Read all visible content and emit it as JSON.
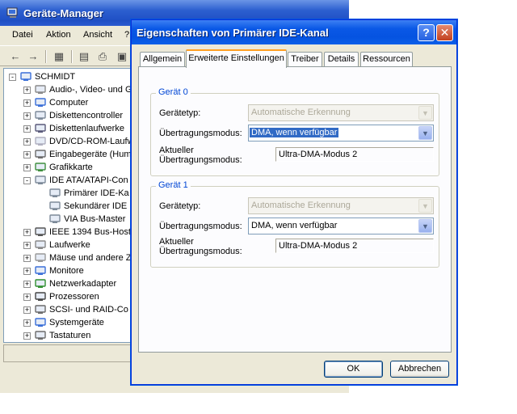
{
  "device_manager": {
    "title": "Geräte-Manager",
    "menu": [
      "Datei",
      "Aktion",
      "Ansicht",
      "?"
    ],
    "tree": [
      {
        "label": "SCHMIDT",
        "indent": 0,
        "expander": "-",
        "icon": "computer-icon"
      },
      {
        "label": "Audio-, Video- und G",
        "indent": 1,
        "expander": "+",
        "icon": "sound-icon"
      },
      {
        "label": "Computer",
        "indent": 1,
        "expander": "+",
        "icon": "computer-icon"
      },
      {
        "label": "Diskettencontroller",
        "indent": 1,
        "expander": "+",
        "icon": "controller-icon"
      },
      {
        "label": "Diskettenlaufwerke",
        "indent": 1,
        "expander": "+",
        "icon": "floppy-icon"
      },
      {
        "label": "DVD/CD-ROM-Laufw",
        "indent": 1,
        "expander": "+",
        "icon": "cdrom-icon"
      },
      {
        "label": "Eingabegeräte (Hum",
        "indent": 1,
        "expander": "+",
        "icon": "keyboard-icon"
      },
      {
        "label": "Grafikkarte",
        "indent": 1,
        "expander": "+",
        "icon": "display-icon"
      },
      {
        "label": "IDE ATA/ATAPI-Con",
        "indent": 1,
        "expander": "-",
        "icon": "controller-icon"
      },
      {
        "label": "Primärer IDE-Ka",
        "indent": 2,
        "expander": "",
        "icon": "controller-icon"
      },
      {
        "label": "Sekundärer IDE",
        "indent": 2,
        "expander": "",
        "icon": "controller-icon"
      },
      {
        "label": "VIA Bus-Master",
        "indent": 2,
        "expander": "",
        "icon": "controller-icon"
      },
      {
        "label": "IEEE 1394 Bus-Host",
        "indent": 1,
        "expander": "+",
        "icon": "ieee-icon"
      },
      {
        "label": "Laufwerke",
        "indent": 1,
        "expander": "+",
        "icon": "drive-icon"
      },
      {
        "label": "Mäuse und andere Z",
        "indent": 1,
        "expander": "+",
        "icon": "mouse-icon"
      },
      {
        "label": "Monitore",
        "indent": 1,
        "expander": "+",
        "icon": "monitor-icon"
      },
      {
        "label": "Netzwerkadapter",
        "indent": 1,
        "expander": "+",
        "icon": "network-icon"
      },
      {
        "label": "Prozessoren",
        "indent": 1,
        "expander": "+",
        "icon": "cpu-icon"
      },
      {
        "label": "SCSI- und RAID-Co",
        "indent": 1,
        "expander": "+",
        "icon": "scsi-icon"
      },
      {
        "label": "Systemgeräte",
        "indent": 1,
        "expander": "+",
        "icon": "system-icon"
      },
      {
        "label": "Tastaturen",
        "indent": 1,
        "expander": "+",
        "icon": "keyboard-icon"
      }
    ]
  },
  "dialog": {
    "title": "Eigenschaften von Primärer IDE-Kanal",
    "help_glyph": "?",
    "close_glyph": "✕",
    "tabs": [
      {
        "label": "Allgemein",
        "active": false
      },
      {
        "label": "Erweiterte Einstellungen",
        "active": true
      },
      {
        "label": "Treiber",
        "active": false
      },
      {
        "label": "Details",
        "active": false
      },
      {
        "label": "Ressourcen",
        "active": false
      }
    ],
    "groups": [
      {
        "title": "Gerät 0",
        "device_type_label": "Gerätetyp:",
        "device_type_value": "Automatische Erkennung",
        "transfer_mode_label": "Übertragungsmodus:",
        "transfer_mode_value": "DMA, wenn verfügbar",
        "current_label_line1": "Aktueller",
        "current_label_line2": "Übertragungsmodus:",
        "current_value": "Ultra-DMA-Modus 2"
      },
      {
        "title": "Gerät 1",
        "device_type_label": "Gerätetyp:",
        "device_type_value": "Automatische Erkennung",
        "transfer_mode_label": "Übertragungsmodus:",
        "transfer_mode_value": "DMA, wenn verfügbar",
        "current_label_line1": "Aktueller",
        "current_label_line2": "Übertragungsmodus:",
        "current_value": "Ultra-DMA-Modus 2"
      }
    ],
    "ok_label": "OK",
    "cancel_label": "Abbrechen"
  },
  "colors": {
    "xp_title_blue": "#0553e1",
    "group_title_blue": "#0046d5",
    "selection_blue": "#316ac5",
    "tab_accent": "#ff9f21"
  }
}
